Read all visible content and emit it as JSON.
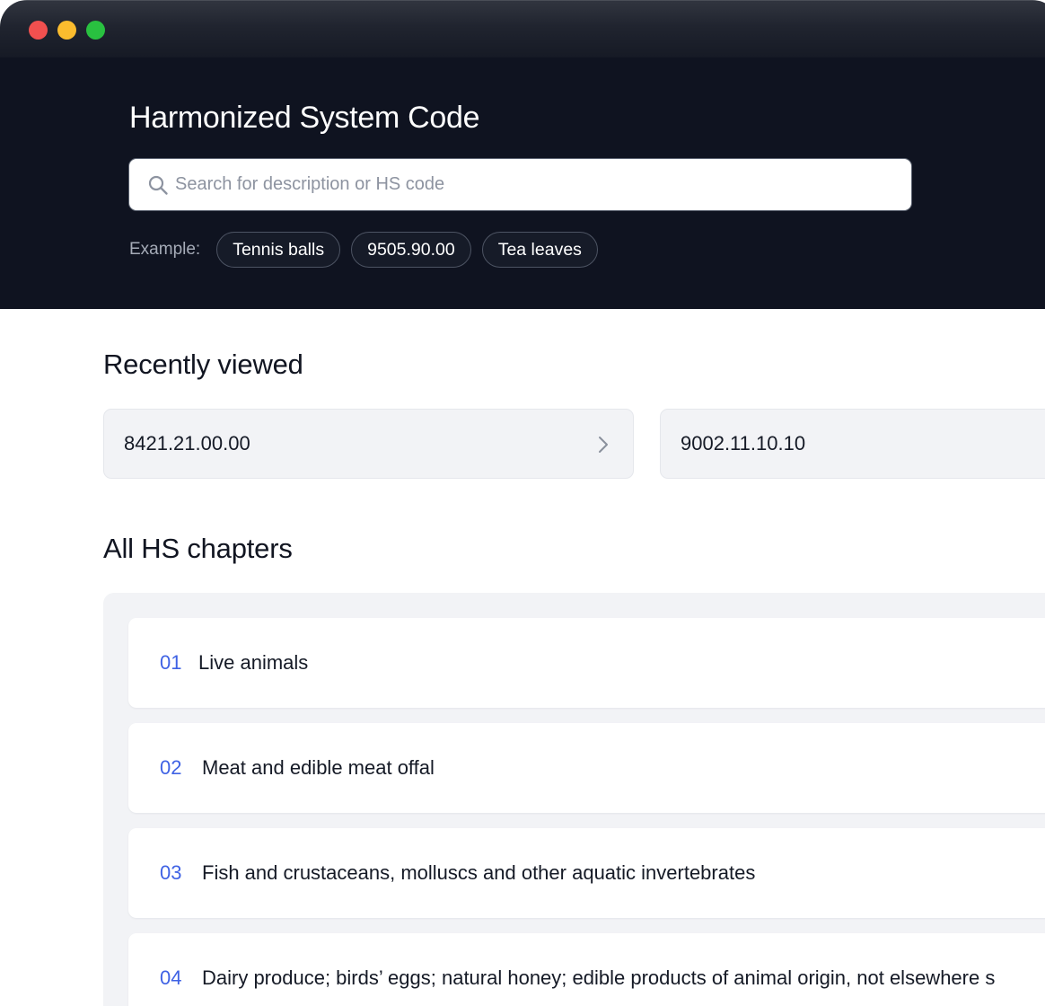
{
  "header": {
    "title": "Harmonized System Code",
    "search_placeholder": "Search for description or HS code",
    "examples_label": "Example:",
    "examples": [
      "Tennis balls",
      "9505.90.00",
      "Tea leaves"
    ]
  },
  "recent": {
    "title": "Recently viewed",
    "items": [
      "8421.21.00.00",
      "9002.11.10.10"
    ]
  },
  "chapters": {
    "title": "All HS chapters",
    "items": [
      {
        "number": "01",
        "description": "Live animals"
      },
      {
        "number": "02",
        "description": "Meat and edible meat offal"
      },
      {
        "number": "03",
        "description": "Fish and crustaceans, molluscs and other aquatic invertebrates"
      },
      {
        "number": "04",
        "description": "Dairy produce; birds’ eggs; natural honey; edible products of animal origin, not elsewhere s"
      }
    ]
  },
  "colors": {
    "header_bg": "#0f1320",
    "accent": "#3f62e4",
    "panel_bg": "#f2f3f6"
  },
  "icons": [
    "search-icon",
    "chevron-right-icon"
  ]
}
